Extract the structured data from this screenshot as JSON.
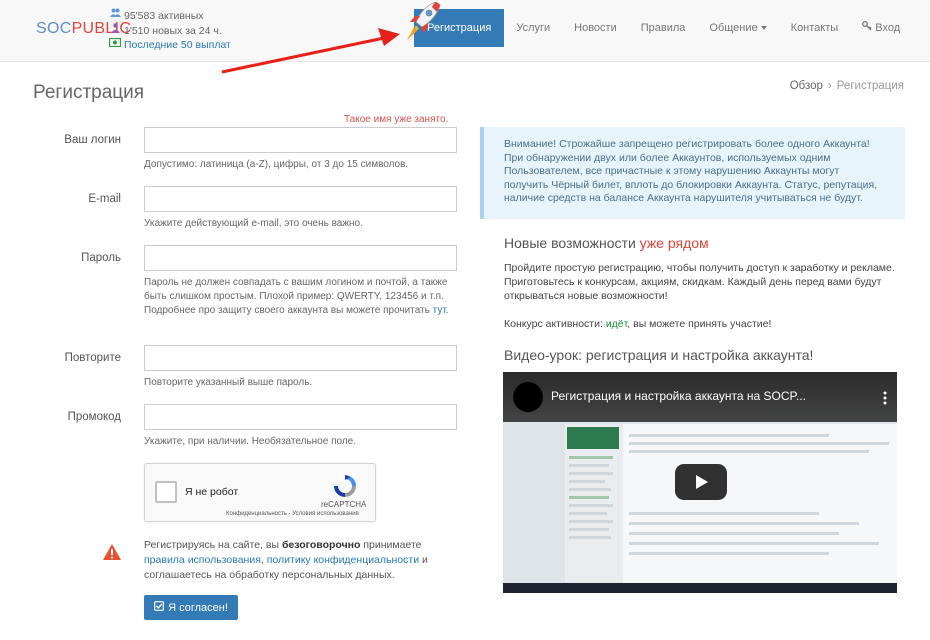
{
  "header": {
    "logo_part1": "SOC",
    "logo_part2": "PUBLIC",
    "stats": {
      "active": "95'583 активных",
      "new24": "1'510 новых за 24 ч.",
      "payouts": "Последние 50 выплат"
    },
    "nav": [
      {
        "label": "Регистрация"
      },
      {
        "label": "Услуги"
      },
      {
        "label": "Новости"
      },
      {
        "label": "Правила"
      },
      {
        "label": "Общение"
      },
      {
        "label": "Контакты"
      },
      {
        "label": "Вход"
      }
    ]
  },
  "page": {
    "title": "Регистрация",
    "breadcrumb": [
      "Обзор",
      "Регистрация"
    ]
  },
  "form": {
    "error_login": "Такое имя уже занято.",
    "login": {
      "label": "Ваш логин",
      "value": "",
      "hint": "Допустимо: латиница (a-Z), цифры, от 3 до 15 символов."
    },
    "email": {
      "label": "E-mail",
      "value": "",
      "hint": "Укажите действующий e-mail, это очень важно."
    },
    "password": {
      "label": "Пароль",
      "value": "",
      "hint": "Пароль не должен совпадать с вашим логином и почтой, а также быть слишком простым. Плохой пример: QWERTY, 123456 и т.п. Подробнее про защиту своего аккаунта вы можете прочитать",
      "hint_link": "тут"
    },
    "repeat": {
      "label": "Повторите",
      "value": "",
      "hint": "Повторите указанный выше пароль."
    },
    "promo": {
      "label": "Промокод",
      "value": "",
      "hint": "Укажите, при наличии. Необязательное поле."
    },
    "captcha": {
      "label": "Я не робот",
      "brand": "reCAPTCHA",
      "terms": "Конфиденциальность - Условия использования"
    },
    "agree": {
      "p1": "Регистрируясь на сайте, вы ",
      "bold": "безоговорочно",
      "p2": " принимаете ",
      "link1": "правила использования",
      "p3": ", ",
      "link2": "политику конфиденциальности",
      "p4": " и соглашаетесь на обработку персональных данных."
    },
    "submit": "Я согласен!"
  },
  "right": {
    "alert": "Внимание! Строжайше запрещено регистрировать более одного Аккаунта! При обнаружении двух или более Аккаунтов, используемых одним Пользователем, все причастные к этому нарушению Аккаунты могут получить Чёрный билет, вплоть до блокировки Аккаунта. Статус, репутация, наличие средств на балансе Аккаунта нарушителя учитываться не будут.",
    "new_title": "Новые возможности ",
    "new_title_hl": "уже рядом",
    "new_text": "Пройдите простую регистрацию, чтобы получить доступ к заработку и рекламе. Приготовьтесь к конкурсам, акциям, скидкам. Каждый день перед вами будут открываться новые возможности!",
    "contest_p1": "Конкурс активности: ",
    "contest_go": "идёт",
    "contest_p2": ", вы можете принять участие!",
    "video_title": "Видео-урок: регистрация и настройка аккаунта!",
    "video_caption": "Регистрация и настройка аккаунта на SOCP..."
  },
  "colors": {
    "primary": "#337ab7",
    "accent_red": "#e0443b",
    "alert_bg": "#e8f4fb",
    "success": "#1e8f2f"
  }
}
